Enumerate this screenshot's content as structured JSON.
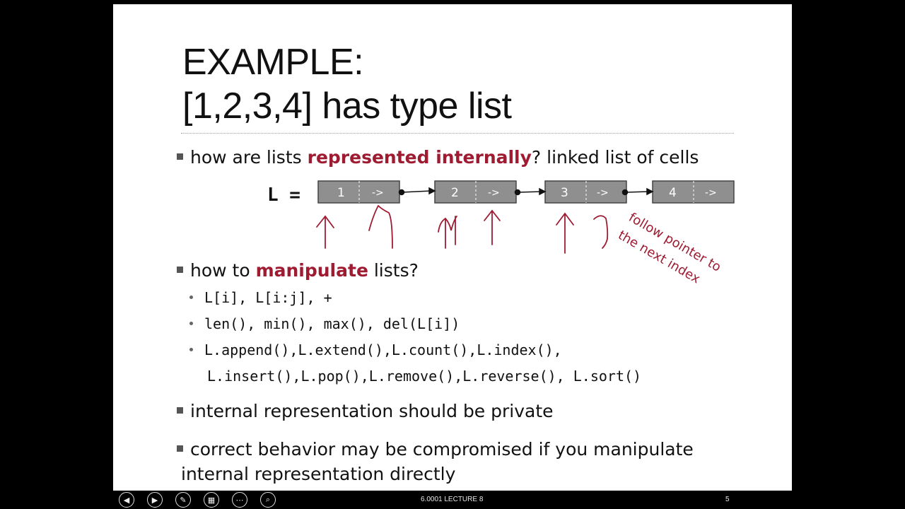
{
  "slide": {
    "title_line1": "EXAMPLE:",
    "title_line2": "[1,2,3,4] has type list",
    "bullet1": {
      "pre": "how are lists ",
      "highlight": "represented internally",
      "post": "? linked list of cells"
    },
    "diagram": {
      "label": "L =",
      "cells": [
        {
          "value": "1",
          "pointer": "->"
        },
        {
          "value": "2",
          "pointer": "->"
        },
        {
          "value": "3",
          "pointer": "->"
        },
        {
          "value": "4",
          "pointer": "->"
        }
      ],
      "annotation_line1": "follow pointer to",
      "annotation_line2": "the next index"
    },
    "bullet2": {
      "pre": "how to ",
      "highlight": "manipulate",
      "post": " lists?"
    },
    "sub_bullets": [
      "L[i], L[i:j], +",
      "len(), min(), max(), del(L[i])",
      "L.append(),L.extend(),L.count(),L.index(),",
      "L.insert(),L.pop(),L.remove(),L.reverse(), L.sort()"
    ],
    "bullet3": "internal representation should be private",
    "bullet4_line1": "correct behavior may be compromised if you manipulate",
    "bullet4_line2": "internal representation directly"
  },
  "taskbar": {
    "footer": "6.0001 LECTURE 8",
    "page": "5",
    "buttons": [
      "previous-slide",
      "next-slide",
      "pen-tool",
      "view-slides",
      "more-options",
      "zoom"
    ]
  },
  "colors": {
    "highlight": "#9e1b32",
    "cell_fill": "#8f8f8f",
    "background": "#000000"
  }
}
